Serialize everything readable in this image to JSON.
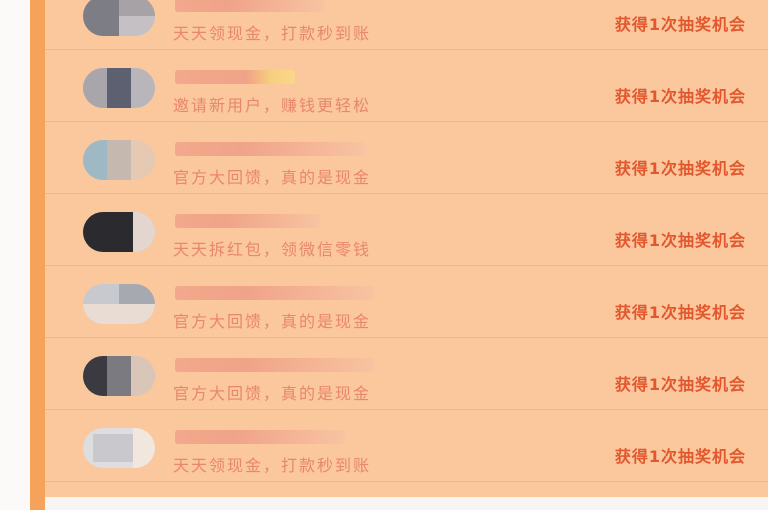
{
  "rows": [
    {
      "description": "天天领现金，打款秒到账",
      "reward": "获得1次抽奖机会",
      "avatar_tones": [
        "#7d7d86",
        "#a6a2a6",
        "#c4c0c3"
      ]
    },
    {
      "description": "邀请新用户，赚钱更轻松",
      "reward": "获得1次抽奖机会",
      "avatar_tones": [
        "#85848c",
        "#5c6070",
        "#b8b6bb"
      ]
    },
    {
      "description": "官方大回馈，真的是现金",
      "reward": "获得1次抽奖机会",
      "avatar_tones": [
        "#9eb9c4",
        "#c5b8ae",
        "#e6c9b3"
      ]
    },
    {
      "description": "天天拆红包，领微信零钱",
      "reward": "获得1次抽奖机会",
      "avatar_tones": [
        "#2b2a2e",
        "#3c3a3e",
        "#e3d6cf"
      ]
    },
    {
      "description": "官方大回馈，真的是现金",
      "reward": "获得1次抽奖机会",
      "avatar_tones": [
        "#c7c9ce",
        "#a7a9b0",
        "#e9dcd3"
      ]
    },
    {
      "description": "官方大回馈，真的是现金",
      "reward": "获得1次抽奖机会",
      "avatar_tones": [
        "#3a3a40",
        "#7b7a80",
        "#d9c6b8"
      ]
    },
    {
      "description": "天天领现金，打款秒到账",
      "reward": "获得1次抽奖机会",
      "avatar_tones": [
        "#c9c8cc",
        "#dedde0",
        "#f2e7df"
      ]
    }
  ]
}
